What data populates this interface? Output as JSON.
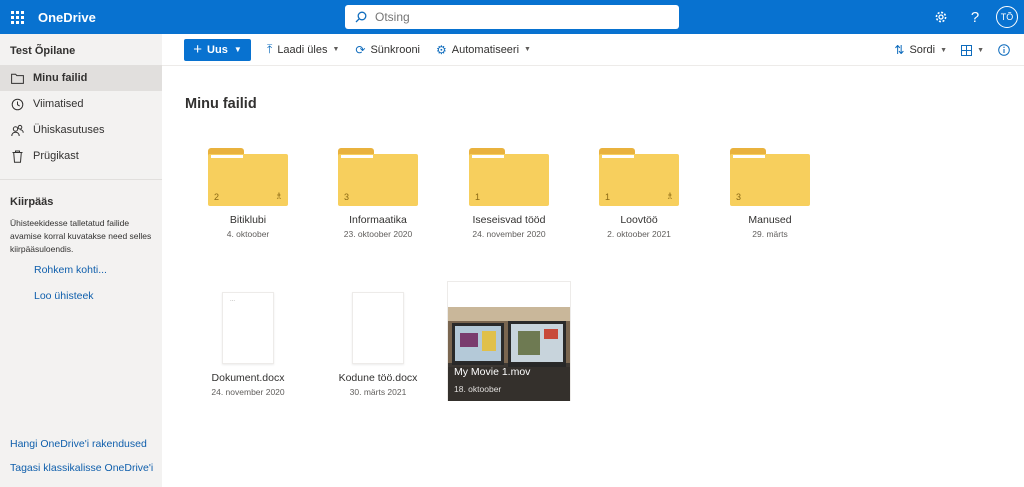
{
  "topbar": {
    "app_name": "OneDrive",
    "search_placeholder": "Otsing",
    "avatar_initials": "TÕ",
    "accent": "#0872d0"
  },
  "sidebar": {
    "user_name": "Test Õpilane",
    "items": [
      {
        "label": "Minu failid",
        "icon": "folder-icon",
        "active": true
      },
      {
        "label": "Viimatised",
        "icon": "history-icon",
        "active": false
      },
      {
        "label": "Ühiskasutuses",
        "icon": "people-icon",
        "active": false
      },
      {
        "label": "Prügikast",
        "icon": "trash-icon",
        "active": false
      }
    ],
    "quick_access_title": "Kiirpääs",
    "quick_access_desc": "Ühisteekidesse talletatud failide avamise korral kuvatakse need selles kiirpääsuloendis.",
    "more_places": "Rohkem kohti...",
    "create_library": "Loo ühisteek",
    "get_apps": "Hangi OneDrive'i rakendused",
    "classic": "Tagasi klassikalisse OneDrive'i"
  },
  "commandbar": {
    "new_label": "Uus",
    "upload_label": "Laadi üles",
    "sync_label": "Sünkrooni",
    "automate_label": "Automatiseeri",
    "sort_label": "Sordi"
  },
  "main": {
    "title": "Minu failid",
    "folders": [
      {
        "name": "Bitiklubi",
        "date": "4. oktoober",
        "count": "2",
        "shared": true
      },
      {
        "name": "Informaatika",
        "date": "23. oktoober 2020",
        "count": "3",
        "shared": false
      },
      {
        "name": "Iseseisvad tööd",
        "date": "24. november 2020",
        "count": "1",
        "shared": false
      },
      {
        "name": "Loovtöö",
        "date": "2. oktoober 2021",
        "count": "1",
        "shared": true
      },
      {
        "name": "Manused",
        "date": "29. märts",
        "count": "3",
        "shared": false
      }
    ],
    "files": [
      {
        "name": "Dokument.docx",
        "date": "24. november 2020"
      },
      {
        "name": "Kodune töö.docx",
        "date": "30. märts 2021"
      }
    ],
    "video": {
      "name": "My Movie 1.mov",
      "date": "18. oktoober"
    }
  }
}
